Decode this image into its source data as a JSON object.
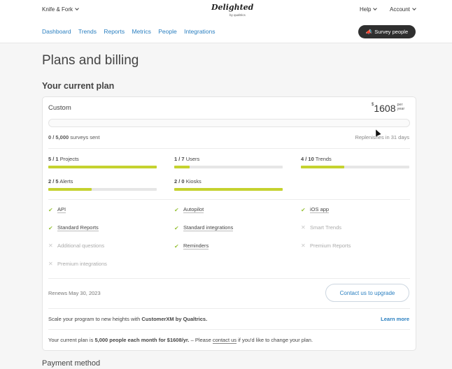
{
  "header": {
    "account_selector": "Knife & Fork",
    "logo_text": "Delighted",
    "logo_sub": "by qualtrics",
    "help": "Help",
    "account": "Account",
    "nav": [
      "Dashboard",
      "Trends",
      "Reports",
      "Metrics",
      "People",
      "Integrations"
    ],
    "survey_button": "Survey people"
  },
  "page": {
    "title": "Plans and billing",
    "current_plan_heading": "Your current plan",
    "payment_heading": "Payment method"
  },
  "plan": {
    "name": "Custom",
    "price_currency": "$",
    "price_amount": "1608",
    "price_per": "per",
    "price_period": "year",
    "surveys_used": "0 / 5,000",
    "surveys_label": "surveys sent",
    "surveys_fraction": 0,
    "replenish": "Replenishes in 31 days"
  },
  "metrics": [
    {
      "used": "5 / 1",
      "label": "Projects",
      "fraction": 1.0
    },
    {
      "used": "1 / 7",
      "label": "Users",
      "fraction": 0.14
    },
    {
      "used": "4 / 10",
      "label": "Trends",
      "fraction": 0.4
    },
    {
      "used": "2 / 5",
      "label": "Alerts",
      "fraction": 0.4
    },
    {
      "used": "2 / 0",
      "label": "Kiosks",
      "fraction": 1.0
    }
  ],
  "features": [
    {
      "label": "API",
      "enabled": true
    },
    {
      "label": "Autopilot",
      "enabled": true
    },
    {
      "label": "iOS app",
      "enabled": true
    },
    {
      "label": "Standard Reports",
      "enabled": true
    },
    {
      "label": "Standard integrations",
      "enabled": true
    },
    {
      "label": "Smart Trends",
      "enabled": false
    },
    {
      "label": "Additional questions",
      "enabled": false
    },
    {
      "label": "Reminders",
      "enabled": true
    },
    {
      "label": "Premium Reports",
      "enabled": false
    },
    {
      "label": "Premium integrations",
      "enabled": false
    }
  ],
  "renewal": {
    "renews": "Renews May 30, 2023",
    "contact_button": "Contact us to upgrade"
  },
  "upsell": {
    "text_pre": "Scale your program to new heights with ",
    "text_bold": "CustomerXM by Qualtrics.",
    "learn_more": "Learn more"
  },
  "footer_note": {
    "pre": "Your current plan is ",
    "plan_bold": "5,000 people each month for $1608/yr.",
    "mid": " – Please ",
    "link": "contact us",
    "post": " if you'd like to change your plan."
  },
  "colors": {
    "accent": "#2a7fc0",
    "bar_fill": "#c5d22f",
    "check": "#9ac43d"
  }
}
